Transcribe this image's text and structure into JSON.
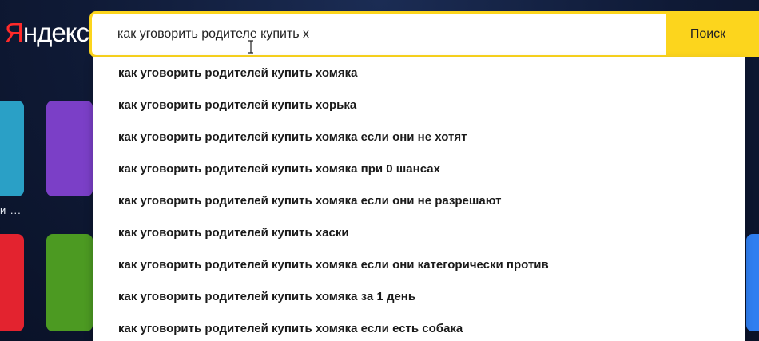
{
  "logo": {
    "first_letter": "Я",
    "rest": "ндекс"
  },
  "search": {
    "value": "как уговорить родителе купить х",
    "button_label": "Поиск"
  },
  "suggestions": [
    "как уговорить родителей купить хомяка",
    "как уговорить родителей купить хорька",
    "как уговорить родителей купить хомяка если они не хотят",
    "как уговорить родителей купить хомяка при 0 шансах",
    "как уговорить родителей купить хомяка если они не разрешают",
    "как уговорить родителей купить хаски",
    "как уговорить родителей купить хомяка если они категорически против",
    "как уговорить родителей купить хомяка за 1 день",
    "как уговорить родителей купить хомяка если есть собака"
  ],
  "background": {
    "tile_caption": "и ..."
  },
  "colors": {
    "accent_yellow": "#fcd51d",
    "logo_red": "#ff2a2a",
    "page_background": "#0f1a36"
  }
}
